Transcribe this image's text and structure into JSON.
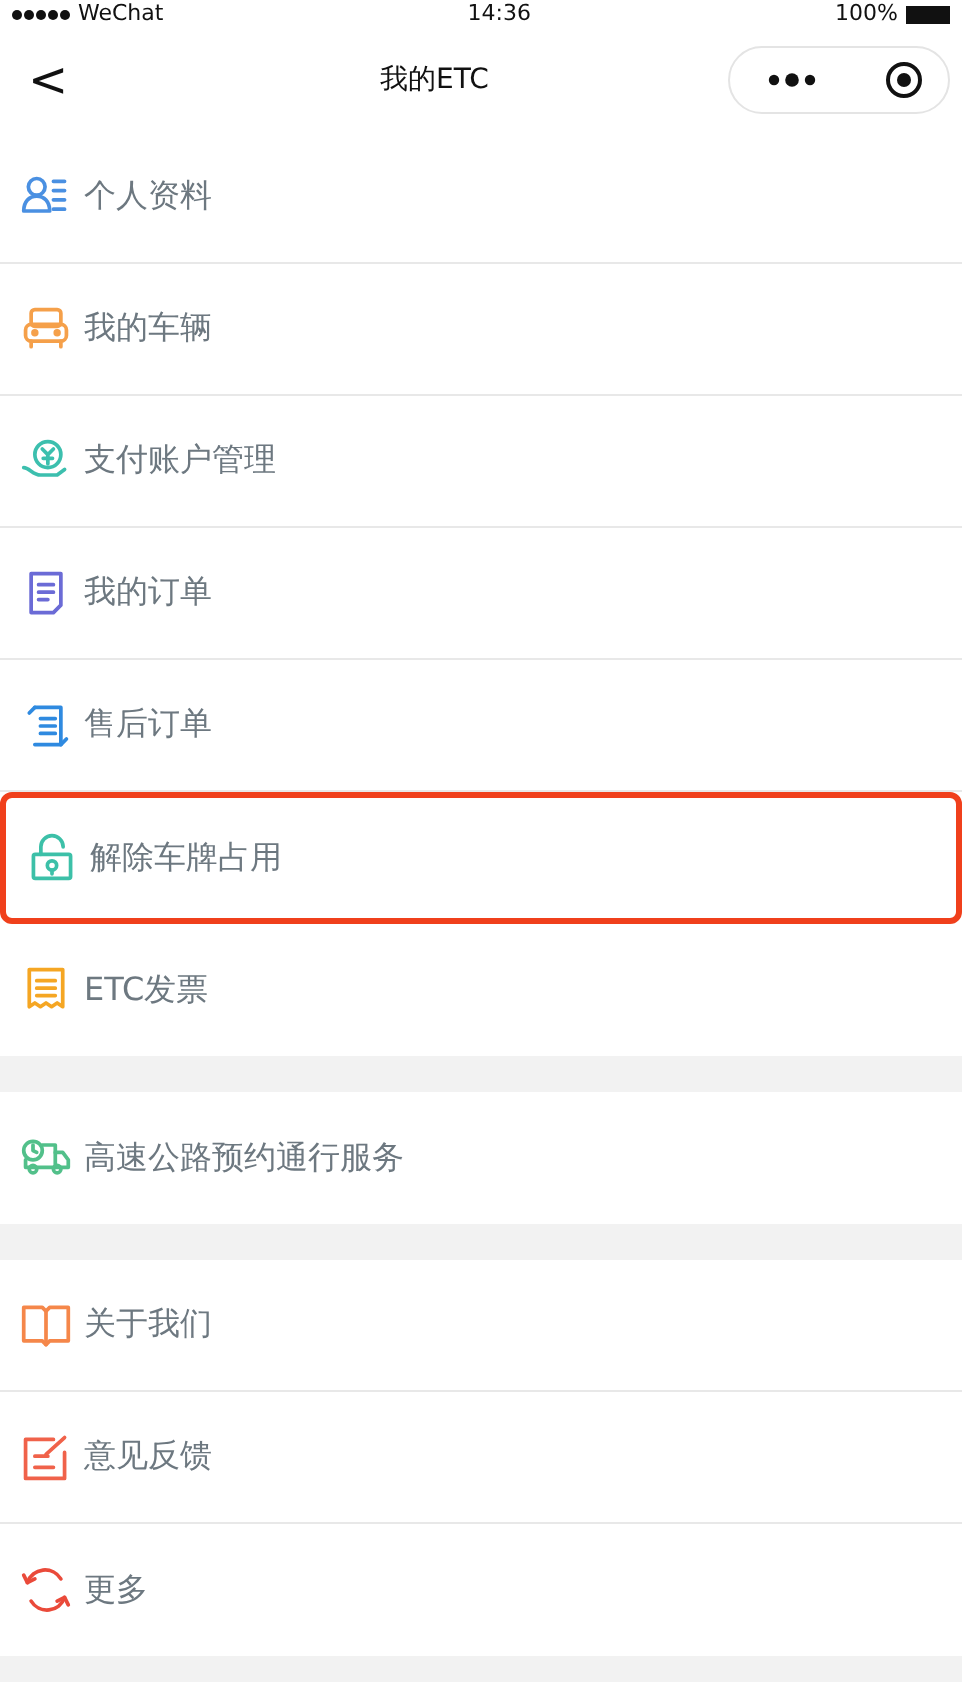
{
  "status_bar": {
    "carrier": "WeChat",
    "time": "14:36",
    "battery": "100%"
  },
  "nav_bar": {
    "back": "<",
    "title": "我的ETC"
  },
  "groups": [
    {
      "items": [
        {
          "label": "个人资料",
          "selected": false
        },
        {
          "label": "我的车辆",
          "selected": false
        },
        {
          "label": "支付账户管理",
          "selected": false
        },
        {
          "label": "我的订单",
          "selected": false
        },
        {
          "label": "售后订单",
          "selected": false
        },
        {
          "label": "解除车牌占用",
          "selected": true
        },
        {
          "label": "ETC发票",
          "selected": false
        }
      ]
    },
    {
      "items": [
        {
          "label": "高速公路预约通行服务",
          "selected": false
        }
      ]
    },
    {
      "items": [
        {
          "label": "关于我们",
          "selected": false
        },
        {
          "label": "意见反馈",
          "selected": false
        },
        {
          "label": "更多",
          "selected": false
        }
      ]
    }
  ]
}
